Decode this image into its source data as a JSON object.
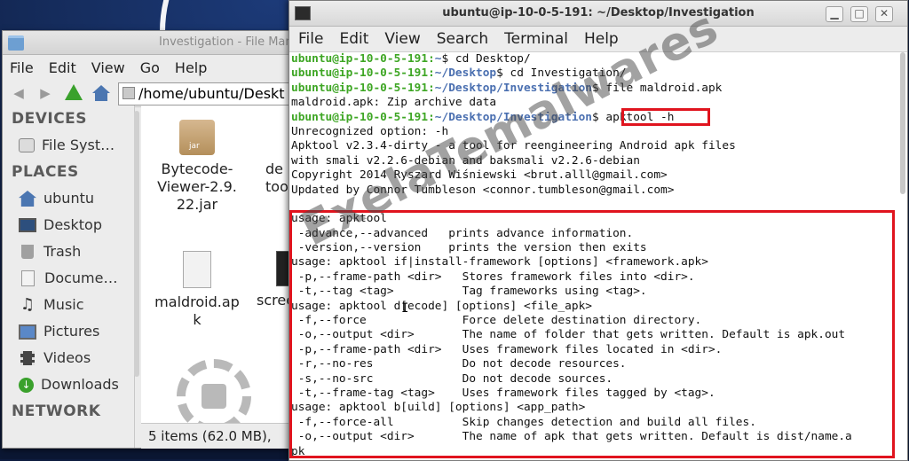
{
  "file_manager": {
    "title": "Investigation - File Mana",
    "menu": [
      "File",
      "Edit",
      "View",
      "Go",
      "Help"
    ],
    "path": "/home/ubuntu/Deskt",
    "sections": {
      "devices": "DEVICES",
      "places": "PLACES",
      "network": "NETWORK"
    },
    "devices": [
      {
        "label": "File Syst…",
        "icon": "drive-icon"
      }
    ],
    "places": [
      {
        "label": "ubuntu",
        "icon": "home-icon"
      },
      {
        "label": "Desktop",
        "icon": "desktop-icon"
      },
      {
        "label": "Trash",
        "icon": "trash-icon"
      },
      {
        "label": "Docume…",
        "icon": "document-icon"
      },
      {
        "label": "Music",
        "icon": "music-icon"
      },
      {
        "label": "Pictures",
        "icon": "pictures-icon"
      },
      {
        "label": "Videos",
        "icon": "videos-icon"
      },
      {
        "label": "Downloads",
        "icon": "downloads-icon"
      }
    ],
    "files": [
      {
        "name": "Bytecode-\nViewer-2.9.\n22.jar",
        "type": "jar"
      },
      {
        "name": "de\ntools-",
        "type": "jar"
      },
      {
        "name": "maldroid.ap\nk",
        "type": "apk"
      },
      {
        "name": "scree",
        "type": "image"
      }
    ],
    "status": "5 items (62.0 MB),"
  },
  "terminal": {
    "title": "ubuntu@ip-10-0-5-191: ~/Desktop/Investigation",
    "menu": [
      "File",
      "Edit",
      "View",
      "Search",
      "Terminal",
      "Help"
    ],
    "prompt_user": "ubuntu@ip-10-0-5-191",
    "lines": [
      {
        "path": "~",
        "cmd": "$ cd Desktop/"
      },
      {
        "path": "~/Desktop",
        "cmd": "$ cd Investigation/"
      },
      {
        "path": "~/Desktop/Investigation",
        "cmd": "$ file maldroid.apk"
      },
      {
        "text": "maldroid.apk: Zip archive data"
      },
      {
        "path": "~/Desktop/Investigation",
        "cmd": "$ apktool -h"
      },
      {
        "text": "Unrecognized option: -h"
      },
      {
        "text": "Apktool v2.3.4-dirty - a tool for reengineering Android apk files"
      },
      {
        "text": "with smali v2.2.6-debian and baksmali v2.2.6-debian"
      },
      {
        "text": "Copyright 2014 Ryszard Wiśniewski <brut.alll@gmail.com>"
      },
      {
        "text": "Updated by Connor Tumbleson <connor.tumbleson@gmail.com>"
      },
      {
        "text": ""
      },
      {
        "text": "usage: apktool"
      },
      {
        "text": " -advance,--advanced   prints advance information."
      },
      {
        "text": " -version,--version    prints the version then exits"
      },
      {
        "text": "usage: apktool if|install-framework [options] <framework.apk>"
      },
      {
        "text": " -p,--frame-path <dir>   Stores framework files into <dir>."
      },
      {
        "text": " -t,--tag <tag>          Tag frameworks using <tag>."
      },
      {
        "text": "usage: apktool d[ecode] [options] <file_apk>"
      },
      {
        "text": " -f,--force              Force delete destination directory."
      },
      {
        "text": " -o,--output <dir>       The name of folder that gets written. Default is apk.out"
      },
      {
        "text": " -p,--frame-path <dir>   Uses framework files located in <dir>."
      },
      {
        "text": " -r,--no-res             Do not decode resources."
      },
      {
        "text": " -s,--no-src             Do not decode sources."
      },
      {
        "text": " -t,--frame-tag <tag>    Uses framework files tagged by <tag>."
      },
      {
        "text": "usage: apktool b[uild] [options] <app_path>"
      },
      {
        "text": " -f,--force-all          Skip changes detection and build all files."
      },
      {
        "text": " -o,--output <dir>       The name of apk that gets written. Default is dist/name.a"
      },
      {
        "text": "pk"
      }
    ]
  },
  "watermark": "ExelaTemalwares",
  "colors": {
    "prompt_user": "#3ea624",
    "prompt_path": "#4a6fb0",
    "highlight": "#e0141e"
  }
}
